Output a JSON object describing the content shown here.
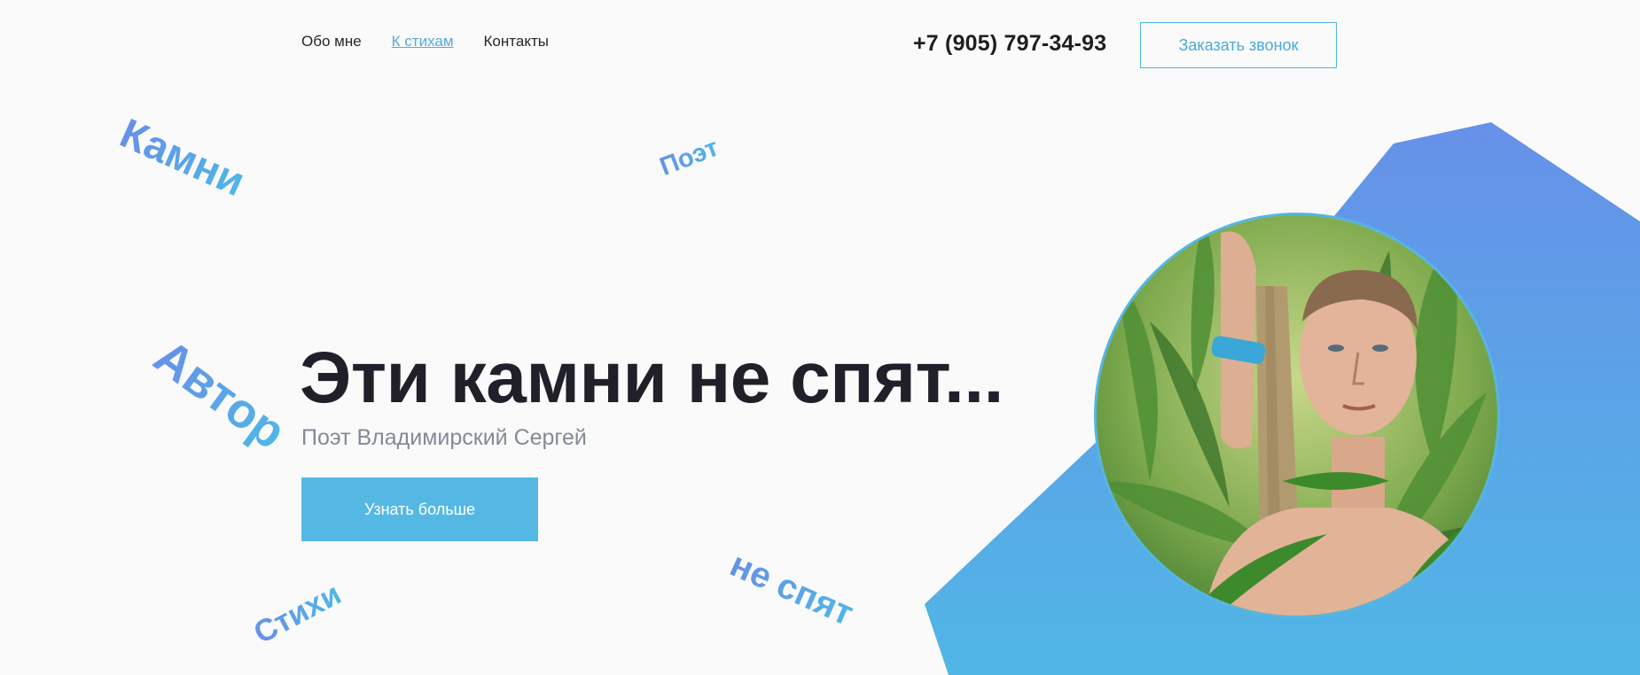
{
  "nav": {
    "items": [
      {
        "label": "Обо мне",
        "active": false
      },
      {
        "label": "К стихам",
        "active": true
      },
      {
        "label": "Контакты",
        "active": false
      }
    ]
  },
  "header": {
    "phone": "+7 (905) 797-34-93",
    "call_button": "Заказать звонок"
  },
  "hero": {
    "title": "Эти камни не спят...",
    "subtitle": "Поэт Владимирский Сергей",
    "cta": "Узнать больше"
  },
  "decor_words": {
    "kamni": "Камни",
    "poet": "Поэт",
    "avtor": "Автор",
    "stihi": "Стихи",
    "ne_spyat": "не спят"
  },
  "colors": {
    "accent": "#55b8e4",
    "gradient_top": "#6691e8",
    "gradient_bottom": "#50b6e6",
    "title": "#20202a",
    "subtitle": "#828a98"
  },
  "icons": {
    "portrait": "portrait-photo"
  }
}
